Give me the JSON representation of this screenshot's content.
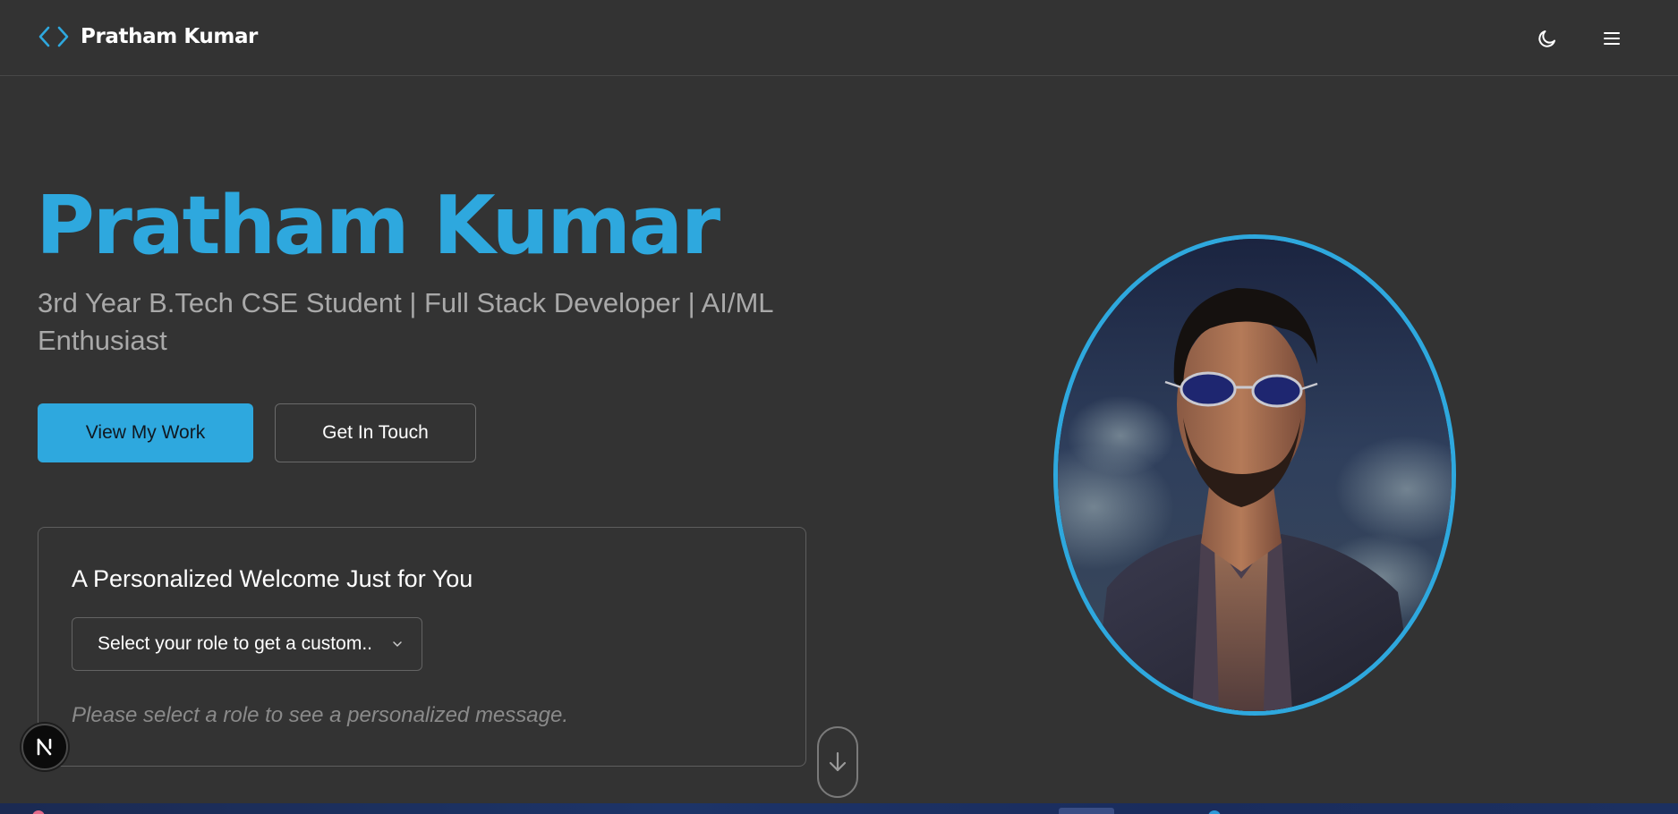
{
  "header": {
    "brand_name": "Pratham Kumar",
    "brand_icon": "code-brackets-icon",
    "theme_toggle_icon": "moon-icon",
    "menu_icon": "hamburger-menu-icon"
  },
  "hero": {
    "title": "Pratham Kumar",
    "subtitle": "3rd Year B.Tech CSE Student | Full Stack Developer | AI/ML Enthusiast",
    "primary_button": "View My Work",
    "secondary_button": "Get In Touch"
  },
  "welcome_card": {
    "title": "A Personalized Welcome Just for You",
    "select_value": "Select your role to get a custom..",
    "hint": "Please select a role to see a personalized message."
  },
  "profile": {
    "photo_subject": "profile-photo"
  },
  "scroll": {
    "icon": "arrow-down-icon"
  },
  "badge": {
    "letter": "N"
  },
  "colors": {
    "background": "#333333",
    "accent": "#2ea8de",
    "muted_text": "#a9a9a9",
    "border": "#5e5e5e"
  }
}
